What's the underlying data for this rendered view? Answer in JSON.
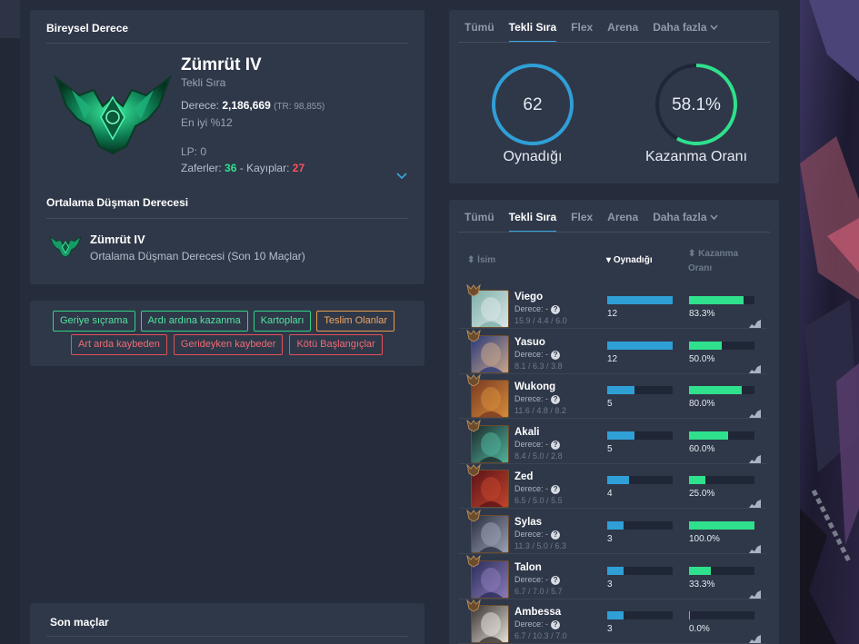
{
  "ranked": {
    "title": "Bireysel Derece",
    "tier": "Zümrüt IV",
    "queue": "Tekli Sıra",
    "rank_label": "Derece:",
    "rank_value": "2,186,669",
    "rank_tr": "(TR: 98,855)",
    "best": "En iyi %12",
    "lp": "LP: 0",
    "wins_label": "Zaferler:",
    "wins": "36",
    "sep": "-",
    "losses_label": "Kayıplar:",
    "losses": "27"
  },
  "avg_enemy": {
    "title": "Ortalama Düşman Derecesi",
    "tier": "Zümrüt IV",
    "desc": "Ortalama Düşman Derecesi (Son 10 Maçlar)"
  },
  "tags": {
    "green": [
      "Geriye sıçrama",
      "Ardı ardına kazanma",
      "Kartopları"
    ],
    "orange": [
      "Teslim Olanlar"
    ],
    "red": [
      "Art arda kaybeden",
      "Gerideyken kaybeder",
      "Kötü Başlangıçlar"
    ]
  },
  "recent": {
    "title": "Son maçlar"
  },
  "tabs": [
    "Tümü",
    "Tekli Sıra",
    "Flex",
    "Arena",
    "Daha fazla"
  ],
  "stats": {
    "played_value": "62",
    "played_label": "Oynadığı",
    "winrate_value": "58.1%",
    "winrate_label": "Kazanma Oranı",
    "winrate_fraction": 0.581
  },
  "champ_table": {
    "col_name": "İsim",
    "col_played": "Oynadığı",
    "col_winrate_1": "Kazanma",
    "col_winrate_2": "Oranı",
    "rank_label": "Derece:",
    "rank_value": "-",
    "max_played": 12,
    "rows": [
      {
        "name": "Viego",
        "kda": [
          "15.9",
          "4.4",
          "6.0"
        ],
        "played": "12",
        "winrate": "83.3%",
        "wr": 83.3,
        "c1": "#7fb0a8",
        "c2": "#d9e6e8"
      },
      {
        "name": "Yasuo",
        "kda": [
          "8.1",
          "6.3",
          "3.8"
        ],
        "played": "12",
        "winrate": "50.0%",
        "wr": 50.0,
        "c1": "#2b3a78",
        "c2": "#c7a58c"
      },
      {
        "name": "Wukong",
        "kda": [
          "11.6",
          "4.8",
          "8.2"
        ],
        "played": "5",
        "winrate": "80.0%",
        "wr": 80.0,
        "c1": "#7a3a22",
        "c2": "#d58b3a"
      },
      {
        "name": "Akali",
        "kda": [
          "8.4",
          "5.0",
          "2.8"
        ],
        "played": "5",
        "winrate": "60.0%",
        "wr": 60.0,
        "c1": "#1e2a2c",
        "c2": "#4fb39a"
      },
      {
        "name": "Zed",
        "kda": [
          "6.5",
          "5.0",
          "5.5"
        ],
        "played": "4",
        "winrate": "25.0%",
        "wr": 25.0,
        "c1": "#5b1418",
        "c2": "#c1432c"
      },
      {
        "name": "Sylas",
        "kda": [
          "11.3",
          "5.0",
          "6.3"
        ],
        "played": "3",
        "winrate": "100.0%",
        "wr": 100.0,
        "c1": "#2a2f3e",
        "c2": "#9aa1b5"
      },
      {
        "name": "Talon",
        "kda": [
          "6.7",
          "7.0",
          "5.7"
        ],
        "played": "3",
        "winrate": "33.3%",
        "wr": 33.3,
        "c1": "#2b2d5a",
        "c2": "#8a7ab8"
      },
      {
        "name": "Ambessa",
        "kda": [
          "6.7",
          "10.3",
          "7.0"
        ],
        "played": "3",
        "winrate": "0.0%",
        "wr": 0.0,
        "c1": "#3a3430",
        "c2": "#e5e0da"
      }
    ]
  },
  "colors": {
    "accent": "#3aa7dd",
    "win": "#2fe08c",
    "loss": "#ff4e5a",
    "played_bar": "#2f9fd6"
  }
}
